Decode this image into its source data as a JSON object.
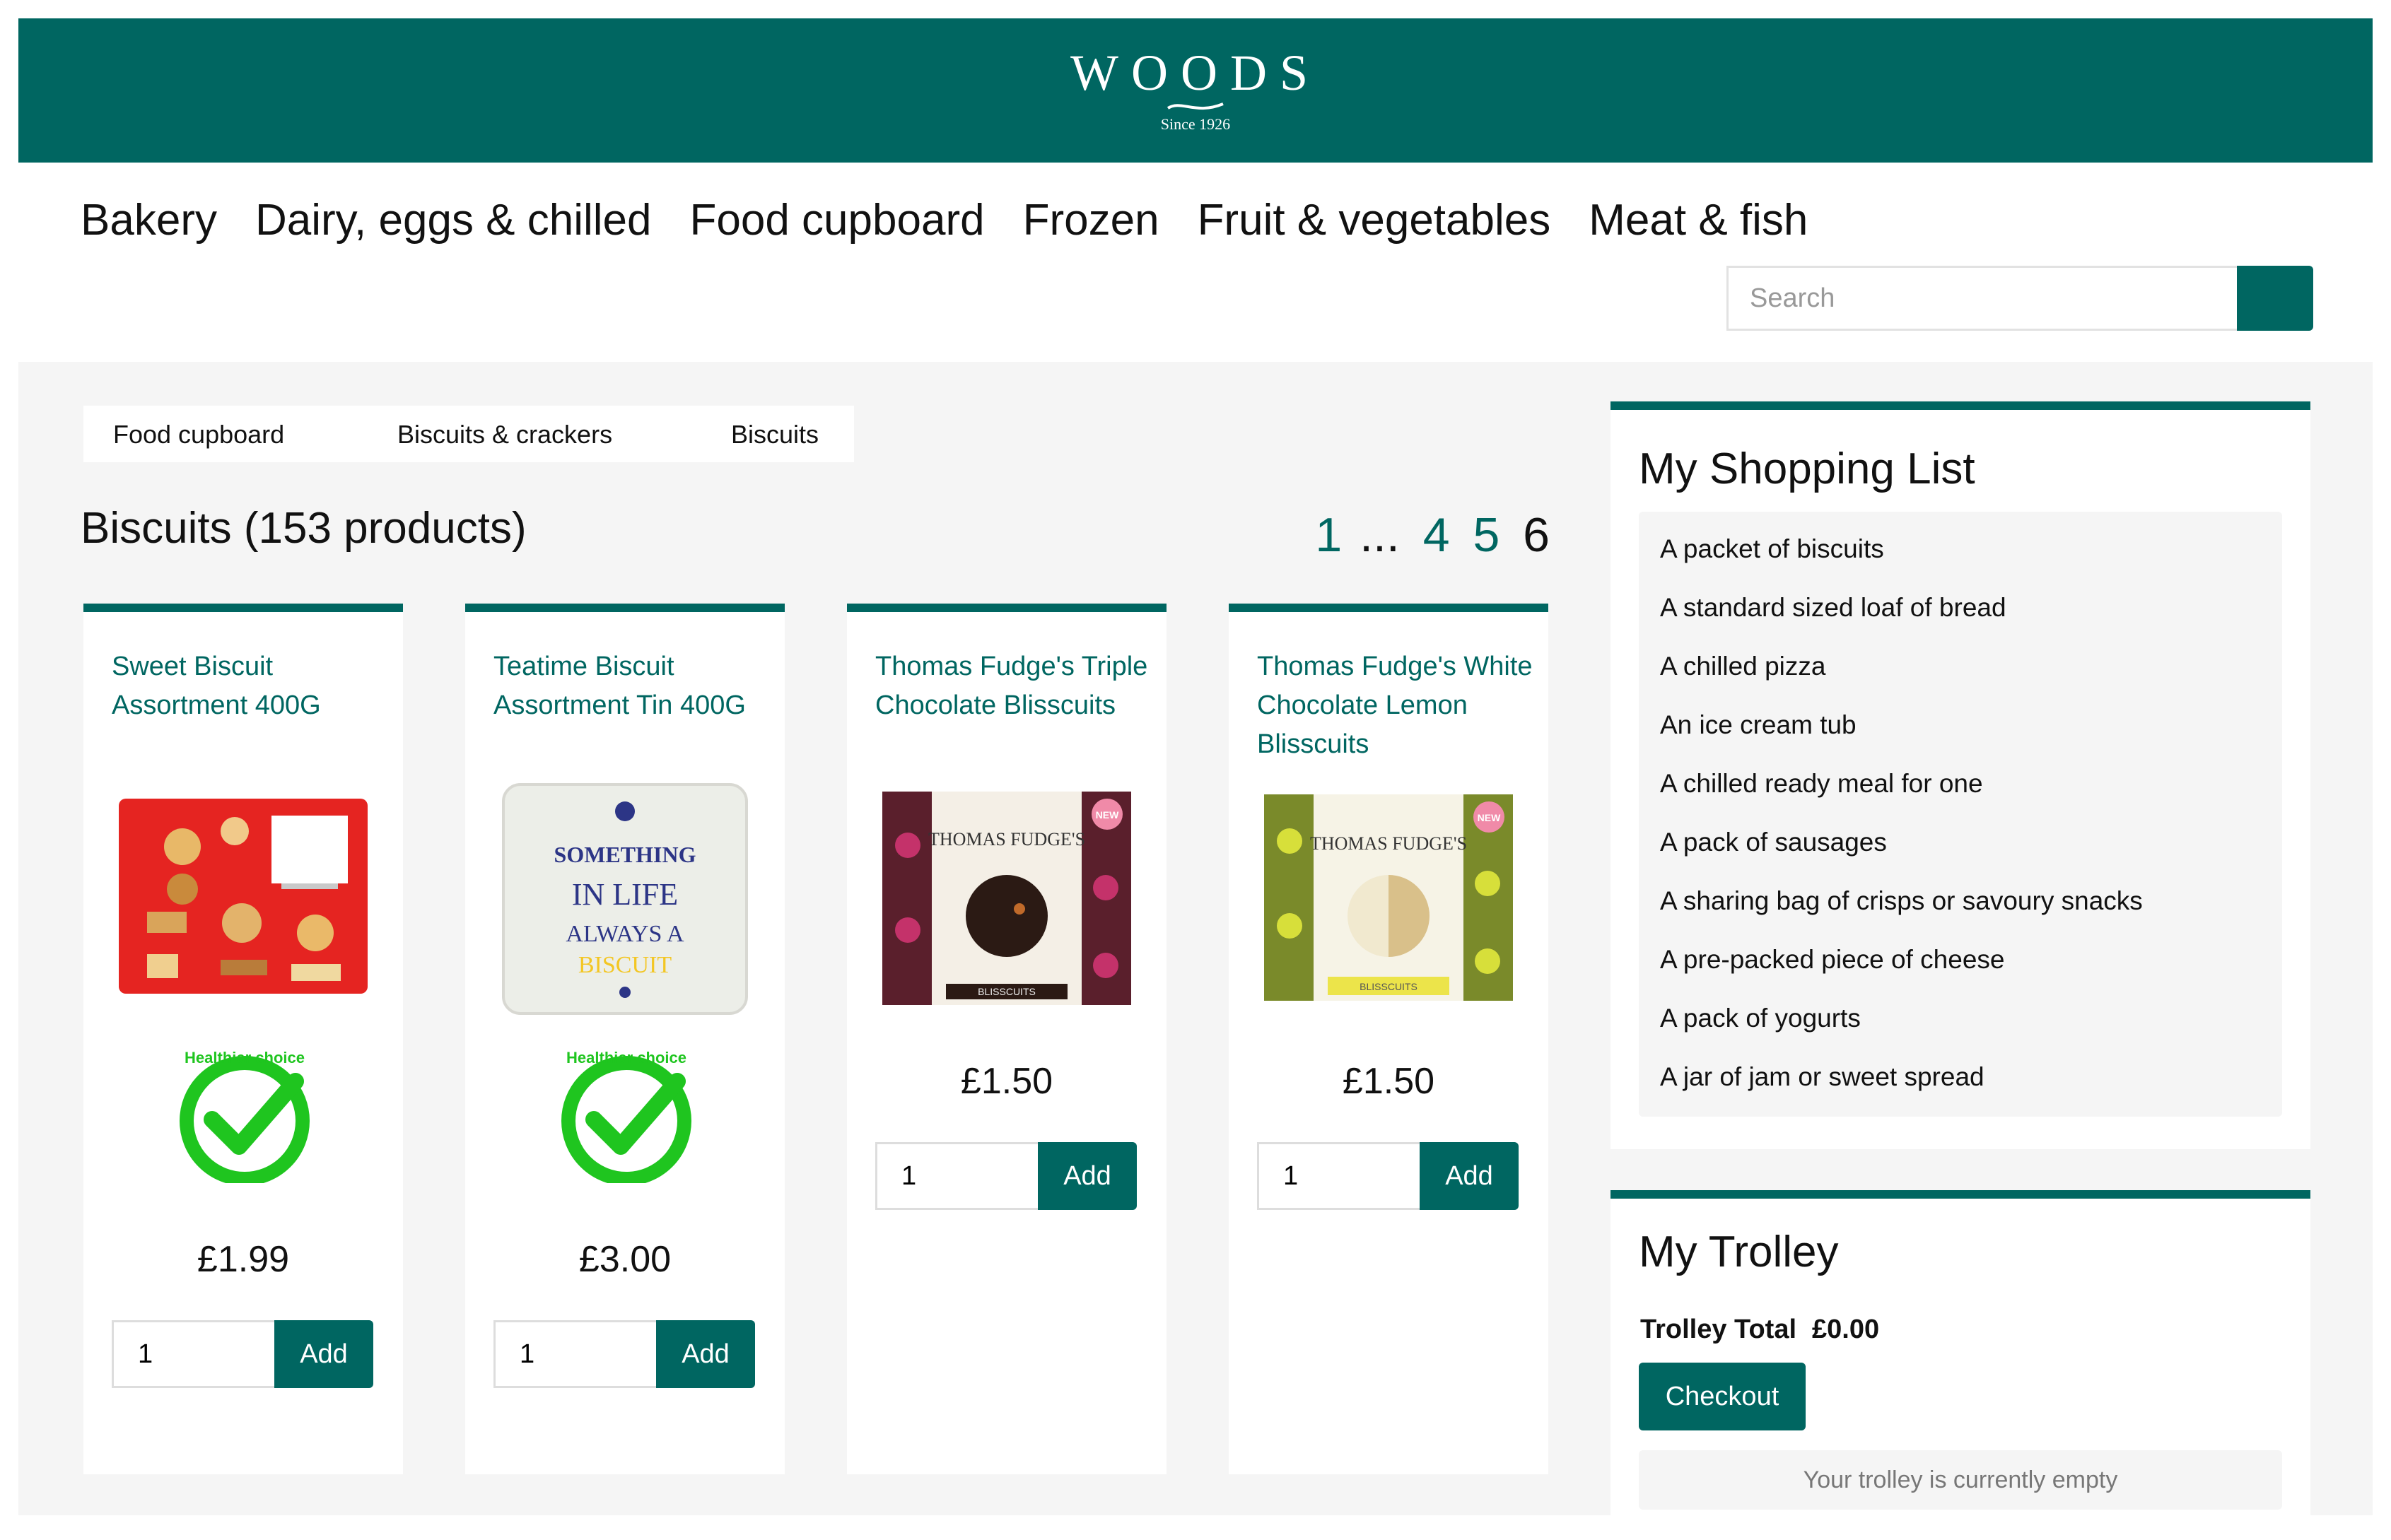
{
  "brand": {
    "logo": "WOODS",
    "since": "Since 1926"
  },
  "nav": [
    "Bakery",
    "Dairy, eggs & chilled",
    "Food cupboard",
    "Frozen",
    "Fruit & vegetables",
    "Meat & fish"
  ],
  "search": {
    "placeholder": "Search"
  },
  "breadcrumb": [
    "Food cupboard",
    "Biscuits & crackers",
    "Biscuits"
  ],
  "page_title": "Biscuits (153 products)",
  "pagination": {
    "first": "1",
    "ellipsis": "...",
    "pages": [
      "4",
      "5"
    ],
    "current": "6"
  },
  "products": [
    {
      "name": "Sweet Biscuit Assortment 400G",
      "price": "£1.99",
      "qty": "1",
      "add": "Add",
      "healthier_choice": true,
      "badge_text": "Healthier choice"
    },
    {
      "name": "Teatime Biscuit Assortment Tin 400G",
      "price": "£3.00",
      "qty": "1",
      "add": "Add",
      "healthier_choice": true,
      "badge_text": "Healthier choice",
      "tin_text": [
        "SOMETHING",
        "IN LIFE",
        "ALWAYS A",
        "BISCUIT"
      ]
    },
    {
      "name": "Thomas Fudge's Triple Chocolate Blisscuits",
      "price": "£1.50",
      "qty": "1",
      "add": "Add",
      "pack_brand": "THOMAS FUDGE'S",
      "pack_label": "BLISSCUITS",
      "new_tag": "NEW"
    },
    {
      "name": "Thomas Fudge's White Chocolate Lemon Blisscuits",
      "price": "£1.50",
      "qty": "1",
      "add": "Add",
      "pack_brand": "THOMAS FUDGE'S",
      "pack_label": "BLISSCUITS",
      "new_tag": "NEW"
    }
  ],
  "shopping_list": {
    "title": "My Shopping List",
    "items": [
      "A packet of biscuits",
      "A standard sized loaf of bread",
      "A chilled pizza",
      "An ice cream tub",
      "A chilled ready meal for one",
      "A pack of sausages",
      "A sharing bag of crisps or savoury snacks",
      "A pre-packed piece of cheese",
      "A pack of yogurts",
      "A jar of jam or sweet spread"
    ]
  },
  "trolley": {
    "title": "My Trolley",
    "total_label": "Trolley Total",
    "total_value": "£0.00",
    "checkout": "Checkout",
    "empty_message": "Your trolley is currently empty"
  },
  "colors": {
    "brand": "#006661",
    "healthy": "#1fc51f",
    "background": "#f5f5f5"
  }
}
